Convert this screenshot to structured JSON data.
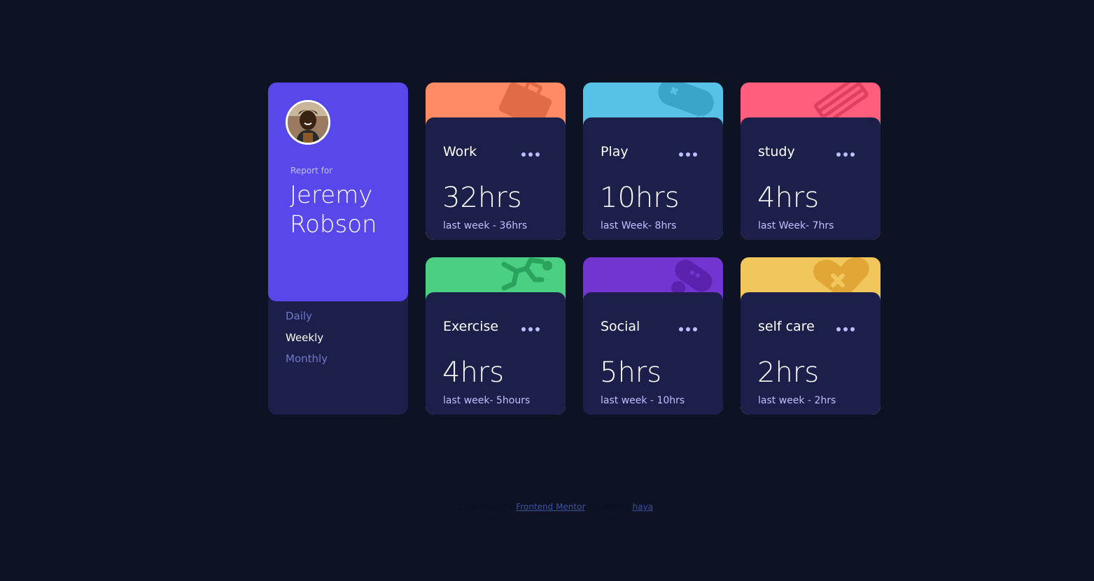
{
  "profile": {
    "report_label": "Report for",
    "first_name": "Jeremy",
    "last_name": "Robson",
    "periods": [
      "Daily",
      "Weekly",
      "Monthly"
    ],
    "active_period": "Weekly"
  },
  "activities": [
    {
      "title": "Work",
      "current": "32hrs",
      "previous": "last week - 36hrs",
      "color": "#ff8b64",
      "icon": "briefcase-icon"
    },
    {
      "title": "Play",
      "current": "10hrs",
      "previous": "last Week- 8hrs",
      "color": "#55c2e6",
      "icon": "gamepad-icon"
    },
    {
      "title": "study",
      "current": "4hrs",
      "previous": "last Week- 7hrs",
      "color": "#ff5e7d",
      "icon": "books-icon"
    },
    {
      "title": "Exercise",
      "current": "4hrs",
      "previous": "last week- 5hours",
      "color": "#4bcf82",
      "icon": "running-icon"
    },
    {
      "title": "Social",
      "current": "5hrs",
      "previous": "last week - 10hrs",
      "color": "#7335d2",
      "icon": "social-icon"
    },
    {
      "title": "self care",
      "current": "2hrs",
      "previous": "last week - 2hrs",
      "color": "#f1c75b",
      "icon": "heart-icon"
    }
  ],
  "attribution": {
    "prefix": "Challenge by",
    "link1": "Frontend Mentor",
    "middle": ". Coded by",
    "link2": "haya"
  },
  "colors": {
    "background": "#0d1323",
    "card": "#1c1f4a",
    "profile_accent": "#5847eb",
    "muted_text": "#bdc1ff"
  }
}
